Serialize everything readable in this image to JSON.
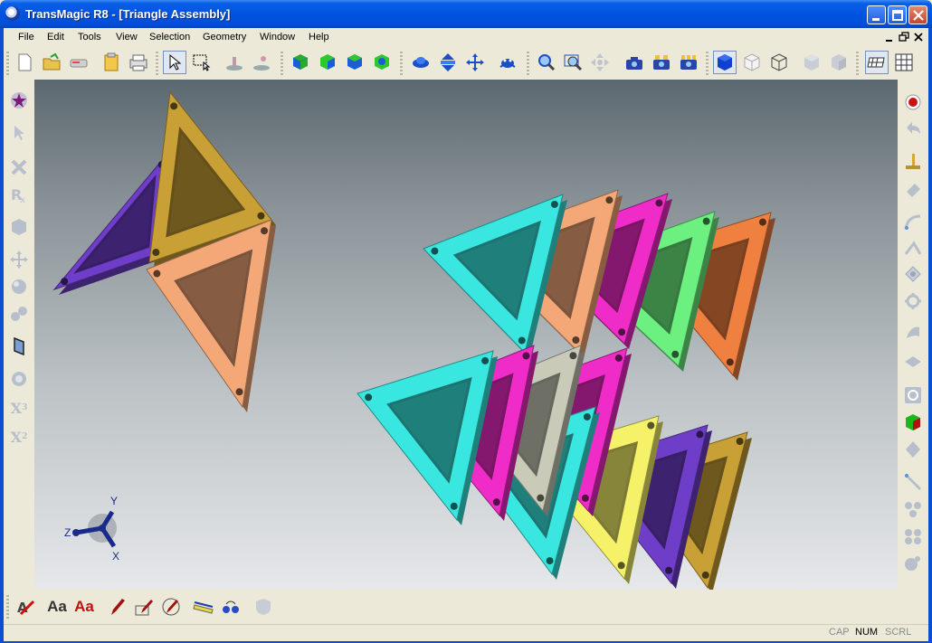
{
  "window": {
    "title": "TransMagic R8 - [Triangle Assembly]"
  },
  "menu": [
    "File",
    "Edit",
    "Tools",
    "View",
    "Selection",
    "Geometry",
    "Window",
    "Help"
  ],
  "toolbar": {
    "icons": [
      "new-file-icon",
      "open-folder-icon",
      "scanner-icon",
      "paste-icon",
      "print-icon",
      "select-arrow-icon",
      "box-select-icon",
      "pick-part-icon",
      "pick-body-icon",
      "cube-green-1-icon",
      "cube-green-2-icon",
      "cube-green-3-icon",
      "cube-green-4-icon",
      "rotate-view-icon",
      "pan-vertical-icon",
      "move-arrows-icon",
      "spider-icon",
      "zoom-fit-icon",
      "zoom-window-icon",
      "zoom-all-icon",
      "camera-1-icon",
      "camera-2-icon",
      "camera-3-icon",
      "shaded-cube-icon",
      "light-cube-icon",
      "wireframe-cube-icon",
      "grey-cube-1-icon",
      "grey-cube-2-icon",
      "grid-1-icon",
      "grid-2-icon"
    ]
  },
  "left_panel": {
    "icons": [
      "star-icon",
      "cursor-icon",
      "delete-icon",
      "rx-icon",
      "cube-icon",
      "move-icon",
      "sphere-icon",
      "spheres-icon",
      "parallelogram-icon",
      "circle-icon",
      "x-cubed-icon",
      "x-squared-icon"
    ],
    "x3_label": "X",
    "x3_sup": "3",
    "x2_label": "X",
    "x2_sup": "2"
  },
  "right_panel": {
    "icons": [
      "record-icon",
      "undo-icon",
      "brush-icon",
      "eraser-icon",
      "curve-icon",
      "line-icon",
      "face-icon",
      "cog-icon",
      "surface-icon",
      "plane-icon",
      "refresh-icon",
      "green-cube-icon",
      "diamond-icon",
      "segment-icon",
      "sphere-group-1-icon",
      "sphere-group-2-icon",
      "sphere-group-3-icon"
    ]
  },
  "bottom_toolbar": {
    "text_icon_1": "Aa",
    "text_icon_2": "Aa",
    "icons": [
      "red-pen-icon",
      "text-icon",
      "text-red-icon",
      "pen-icon",
      "pen-box-icon",
      "pen-slash-icon",
      "ruler-icon",
      "points-icon",
      "shield-icon"
    ]
  },
  "axis_triad": {
    "y": "Y",
    "z": "Z",
    "x": "X"
  },
  "status": {
    "cap": "CAP",
    "num": "NUM",
    "scrl": "SCRL"
  },
  "colors": {
    "titlebar": "#0053df",
    "face": "#ece9d8",
    "cyan": "#39e6e0",
    "peach": "#f4a878",
    "magenta": "#f02cc8",
    "green": "#6cf080",
    "orange": "#f08040",
    "purple": "#6f3ec9",
    "gold": "#c9a035",
    "grey": "#c9cbb8",
    "yellow": "#f5f26a"
  }
}
